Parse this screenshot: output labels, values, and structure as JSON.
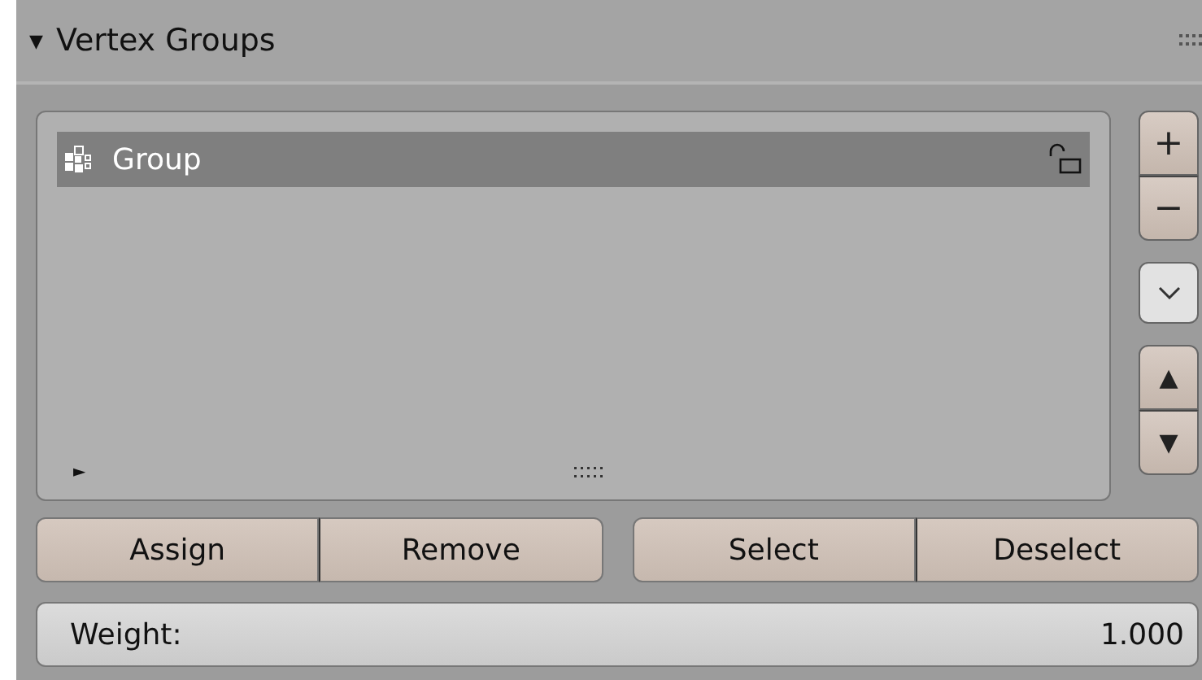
{
  "panel": {
    "title": "Vertex Groups",
    "expanded": true,
    "toggle": "▼"
  },
  "groups": [
    {
      "name": "Group",
      "selected": true,
      "locked": false
    }
  ],
  "list_options_toggle": "►",
  "side_buttons": {
    "add": "+",
    "remove": "−",
    "move_up": "▲",
    "move_down": "▼"
  },
  "actions": [
    [
      "Assign",
      "Remove"
    ],
    [
      "Select",
      "Deselect"
    ]
  ],
  "weight": {
    "label": "Weight:",
    "value": "1.000"
  }
}
